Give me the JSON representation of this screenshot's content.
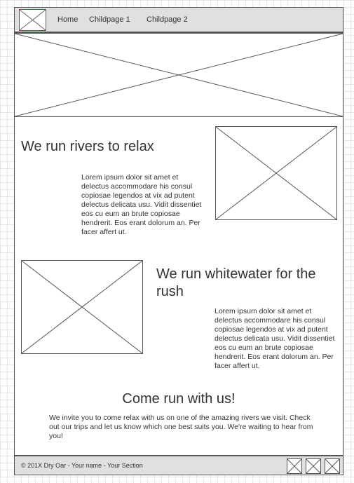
{
  "header": {
    "nav": [
      "Home",
      "Childpage 1",
      "Childpage 2"
    ]
  },
  "section1": {
    "title": "We run rivers to relax",
    "body": "Lorem ipsum dolor sit amet et delectus accommodare his consul copiosae legendos at vix ad putent delectus delicata usu. Vidit dissentiet eos cu eum an brute copiosae hendrerit. Eos erant dolorum an. Per facer affert ut."
  },
  "section2": {
    "title": "We run whitewater for the rush",
    "body": "Lorem ipsum dolor sit amet et delectus accommodare his consul copiosae legendos at vix ad putent delectus delicata usu. Vidit dissentiet eos cu eum an brute copiosae hendrerit. Eos erant dolorum an. Per facer affert ut."
  },
  "cta": {
    "title": "Come run with us!",
    "body": "We invite you to come relax with us on one of the amazing rivers we visit. Check out our trips and let us know which one best suits you. We're waiting to hear from you!"
  },
  "footer": {
    "text": "© 201X Dry Oar - Your name - Your Section",
    "social_icons": [
      "image-placeholder-icon",
      "image-placeholder-icon",
      "image-placeholder-icon"
    ]
  },
  "colors": {
    "header_bg": "#e0e0e0",
    "logo_border": "#b03a3a",
    "wire": "#555555"
  }
}
